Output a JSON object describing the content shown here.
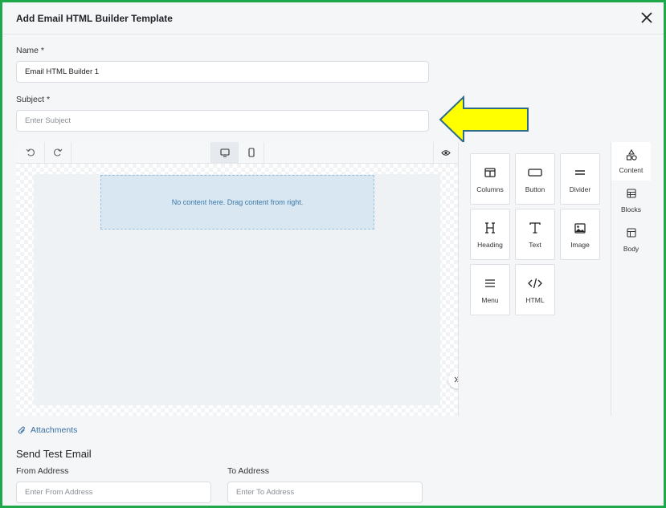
{
  "modal": {
    "title": "Add Email HTML Builder Template"
  },
  "form": {
    "name_label": "Name *",
    "name_value": "Email HTML Builder 1",
    "subject_label": "Subject *",
    "subject_placeholder": "Enter Subject"
  },
  "editor": {
    "dropzone_text": "No content here. Drag content from right.",
    "tiles": [
      {
        "label": "Columns",
        "icon": "columns-icon"
      },
      {
        "label": "Button",
        "icon": "button-icon"
      },
      {
        "label": "Divider",
        "icon": "divider-icon"
      },
      {
        "label": "Heading",
        "icon": "heading-icon"
      },
      {
        "label": "Text",
        "icon": "text-icon"
      },
      {
        "label": "Image",
        "icon": "image-icon"
      },
      {
        "label": "Menu",
        "icon": "menu-icon"
      },
      {
        "label": "HTML",
        "icon": "html-icon"
      }
    ],
    "side_tabs": [
      {
        "label": "Content",
        "icon": "content-icon"
      },
      {
        "label": "Blocks",
        "icon": "blocks-icon"
      },
      {
        "label": "Body",
        "icon": "body-icon"
      }
    ]
  },
  "attachments_label": "Attachments",
  "test_email": {
    "title": "Send Test Email",
    "from_label": "From Address",
    "from_placeholder": "Enter From Address",
    "to_label": "To Address",
    "to_placeholder": "Enter To Address"
  },
  "colors": {
    "frame": "#1fa84a",
    "arrow_fill": "#ffff00",
    "arrow_stroke": "#2e6b8a",
    "link": "#3a6ea5"
  }
}
